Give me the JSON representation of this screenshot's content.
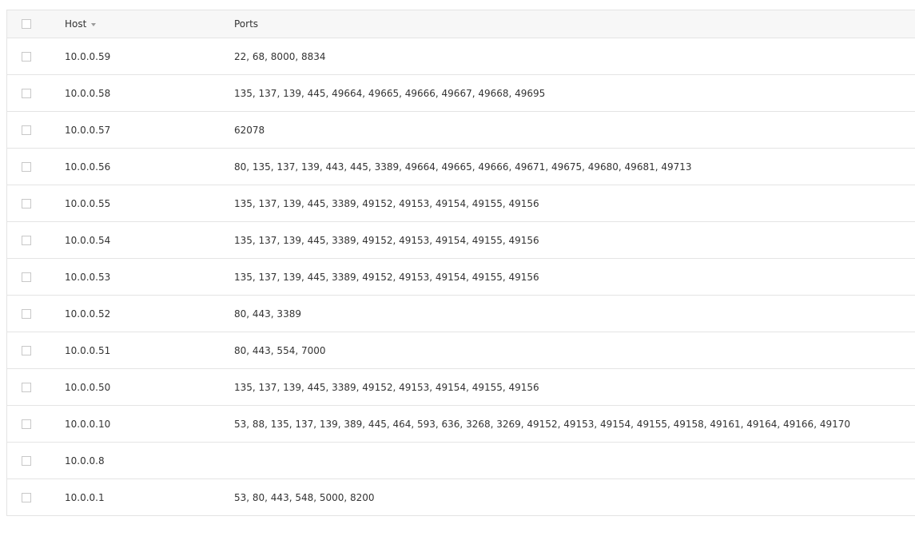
{
  "table": {
    "columns": {
      "host": "Host",
      "ports": "Ports"
    },
    "sort": {
      "column": "host",
      "direction": "desc",
      "icon": "sort-desc-icon"
    },
    "rows": [
      {
        "host": "10.0.0.59",
        "ports": "22, 68, 8000, 8834"
      },
      {
        "host": "10.0.0.58",
        "ports": "135, 137, 139, 445, 49664, 49665, 49666, 49667, 49668, 49695"
      },
      {
        "host": "10.0.0.57",
        "ports": "62078"
      },
      {
        "host": "10.0.0.56",
        "ports": "80, 135, 137, 139, 443, 445, 3389, 49664, 49665, 49666, 49671, 49675, 49680, 49681, 49713"
      },
      {
        "host": "10.0.0.55",
        "ports": "135, 137, 139, 445, 3389, 49152, 49153, 49154, 49155, 49156"
      },
      {
        "host": "10.0.0.54",
        "ports": "135, 137, 139, 445, 3389, 49152, 49153, 49154, 49155, 49156"
      },
      {
        "host": "10.0.0.53",
        "ports": "135, 137, 139, 445, 3389, 49152, 49153, 49154, 49155, 49156"
      },
      {
        "host": "10.0.0.52",
        "ports": "80, 443, 3389"
      },
      {
        "host": "10.0.0.51",
        "ports": "80, 443, 554, 7000"
      },
      {
        "host": "10.0.0.50",
        "ports": "135, 137, 139, 445, 3389, 49152, 49153, 49154, 49155, 49156"
      },
      {
        "host": "10.0.0.10",
        "ports": "53, 88, 135, 137, 139, 389, 445, 464, 593, 636, 3268, 3269, 49152, 49153, 49154, 49155, 49158, 49161, 49164, 49166, 49170"
      },
      {
        "host": "10.0.0.8",
        "ports": ""
      },
      {
        "host": "10.0.0.1",
        "ports": "53, 80, 443, 548, 5000, 8200"
      }
    ]
  }
}
